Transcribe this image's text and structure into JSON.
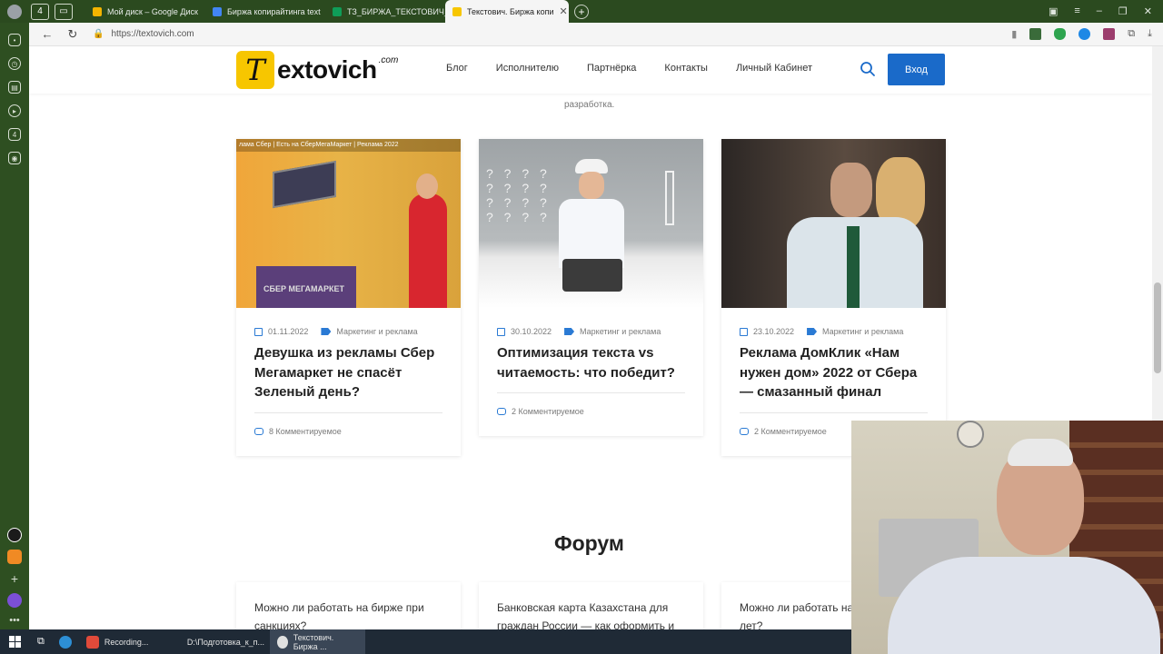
{
  "browser": {
    "tabs": [
      {
        "label": "Мой диск – Google Диск",
        "color": "#f4b400"
      },
      {
        "label": "Биржа копирайтинга text",
        "color": "#4285f4"
      },
      {
        "label": "ТЗ_БИРЖА_ТЕКСТОВИЧ_1",
        "color": "#0f9d58"
      },
      {
        "label": "Текстович. Биржа копи",
        "color": "#f7c600"
      }
    ],
    "url": "https://textovich.com"
  },
  "site": {
    "logo_letter": "T",
    "logo_text": "extovich",
    "logo_com": ".com",
    "menu": [
      "Блог",
      "Исполнителю",
      "Партнёрка",
      "Контакты",
      "Личный Кабинет"
    ],
    "login": "Вход",
    "faded_text": "разработка."
  },
  "posts": [
    {
      "date": "01.11.2022",
      "category": "Маркетинг и реклама",
      "title": "Девушка из рекламы Сбер Мегамаркет не спасёт Зеленый день?",
      "comments": "8 Комментируемое",
      "img_caption": "лама Сбер | Есть на СберМегаМаркет | Реклама 2022",
      "img_brand": "СБЕР МЕГАМАРКЕТ"
    },
    {
      "date": "30.10.2022",
      "category": "Маркетинг и реклама",
      "title": "Оптимизация текста vs читаемость: что победит?",
      "comments": "2 Комментируемое"
    },
    {
      "date": "23.10.2022",
      "category": "Маркетинг и реклама",
      "title": "Реклама ДомКлик «Нам нужен дом» 2022 от Сбера — смазанный финал",
      "comments": "2 Комментируемое"
    }
  ],
  "forum": {
    "title": "Форум",
    "items": [
      "Можно ли работать на бирже при санкциях?",
      "Банковская карта Казахстана для граждан России — как оформить и",
      "Можно ли работать на"
    ],
    "item3_line2": "лет?"
  },
  "taskbar": {
    "items": [
      {
        "label": "Recording...",
        "color": "#e04a3a"
      },
      {
        "label": "D:\\Подготовка_к_п...",
        "color": "#f2c14e"
      },
      {
        "label": "Текстович. Биржа ...",
        "color": "#e0e0e0"
      }
    ]
  }
}
